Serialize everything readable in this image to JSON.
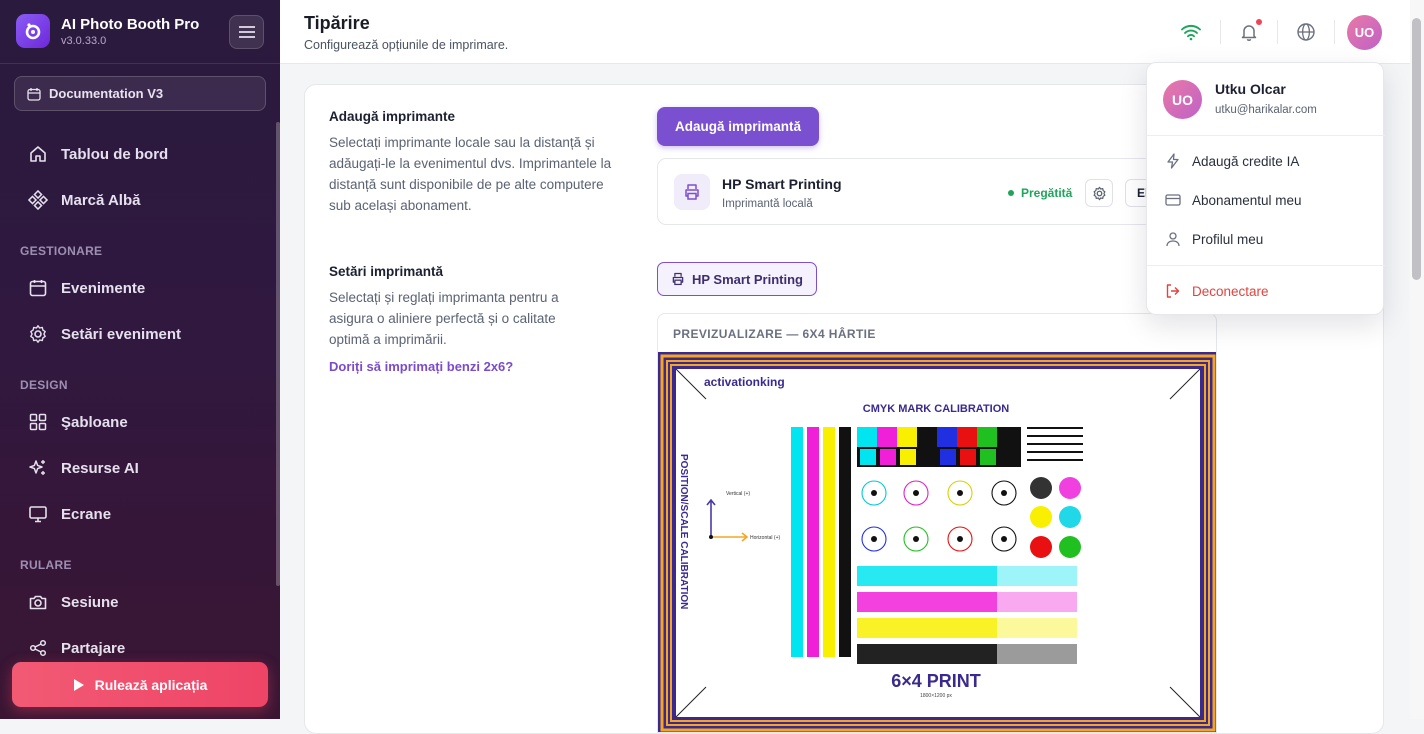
{
  "app": {
    "name": "AI Photo Booth Pro",
    "version": "v3.0.33.0"
  },
  "sidebar": {
    "doc_button": "Documentation V3",
    "items": [
      {
        "label": "Tablou de bord",
        "icon": "home-icon"
      },
      {
        "label": "Marcă Albă",
        "icon": "diamond-icon"
      },
      {
        "label": "Evenimente",
        "icon": "calendar-icon"
      },
      {
        "label": "Setări eveniment",
        "icon": "gear-icon"
      },
      {
        "label": "Şabloane",
        "icon": "grid-icon"
      },
      {
        "label": "Resurse AI",
        "icon": "sparkle-icon"
      },
      {
        "label": "Ecrane",
        "icon": "monitor-icon"
      },
      {
        "label": "Sesiune",
        "icon": "camera-icon"
      },
      {
        "label": "Partajare",
        "icon": "share-icon"
      }
    ],
    "sections": [
      "GESTIONARE",
      "DESIGN",
      "RULARE"
    ],
    "run_button": "Rulează aplicația"
  },
  "header": {
    "title": "Tipărire",
    "subtitle": "Configurează opțiunile de imprimare.",
    "avatar_initials": "UO"
  },
  "add_printer": {
    "title": "Adaugă imprimante",
    "description": "Selectați imprimante locale sau la distanță și adăugați-le la evenimentul dvs. Imprimantele la distanță sunt disponibile de pe alte computere sub același abonament.",
    "button": "Adaugă imprimantă"
  },
  "printer": {
    "name": "HP Smart Printing",
    "type": "Imprimantă locală",
    "status": "Pregătită",
    "more_label": "El"
  },
  "printer_settings": {
    "title": "Setări imprimantă",
    "description": "Selectați și reglați imprimanta pentru a asigura o aliniere perfectă și o calitate optimă a imprimării.",
    "link": "Doriți să imprimați benzi 2x6?",
    "selected_printer": "HP Smart Printing"
  },
  "preview": {
    "label": "PREVIZUALIZARE — 6X4 HÂRTIE",
    "brand": "activationking",
    "heading": "CMYK MARK CALIBRATION",
    "side_label": "POSITION/SCALE CALIBRATION",
    "vertical_label": "Vertical (+)",
    "horizontal_label": "Horizontal (+)",
    "print_title": "6×4 PRINT",
    "print_size": "1800×1200 px"
  },
  "user_menu": {
    "name": "Utku Olcar",
    "email": "utku@harikalar.com",
    "initials": "UO",
    "items": [
      "Adaugă credite IA",
      "Abonamentul meu",
      "Profilul meu"
    ],
    "logout": "Deconectare"
  },
  "colors": {
    "accent": "#7a4fd0",
    "ready": "#1ea55b",
    "danger": "#e0443f",
    "run": "#f25a74"
  }
}
